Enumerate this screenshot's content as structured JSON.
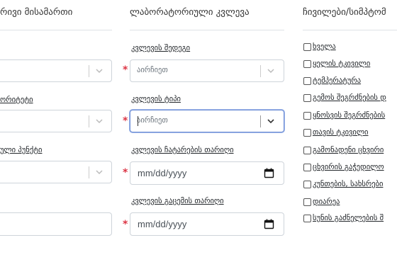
{
  "columns": {
    "referral": {
      "heading": "რივი მისამართი",
      "fields": [
        {
          "label": "",
          "placeholder": ""
        },
        {
          "label": "ორიტეტი",
          "placeholder": ""
        },
        {
          "label": "ული პუნქტი",
          "placeholder": ""
        },
        {
          "label": "",
          "placeholder": ""
        }
      ]
    },
    "lab": {
      "heading": "ლაბორატორიული კვლევა",
      "result": {
        "label": "კვლევის შედეგი",
        "placeholder": "აირჩიეთ"
      },
      "type": {
        "label": "კვლევის ტიპი",
        "placeholder": "აირჩიეთ"
      },
      "date_done": {
        "label": "კვლევის ჩატარების თარიღი",
        "placeholder": "mm/dd/yyyy"
      },
      "date_issued": {
        "label": "კვლევის გაცემის თარიღი",
        "placeholder": "mm/dd/yyyy"
      }
    },
    "symptoms": {
      "heading": "ჩივილები/სიმპტომ",
      "items": [
        "ხველა",
        "ყელის ტკივილი",
        "ტემპერატურა",
        "გემოს შეგრძნების დ",
        "ყნოსვის შეგრძნების",
        "თავის ტკივილი",
        "გამონადენი ცხვირი",
        "ცხვირის გაჭედილო",
        "კუნთების, სახსრები",
        "დიარეა",
        "სუნის გაძნელების შ"
      ]
    }
  },
  "colors": {
    "required": "#dc3545",
    "focus": "#6f8fd6",
    "border": "#ced4da"
  }
}
